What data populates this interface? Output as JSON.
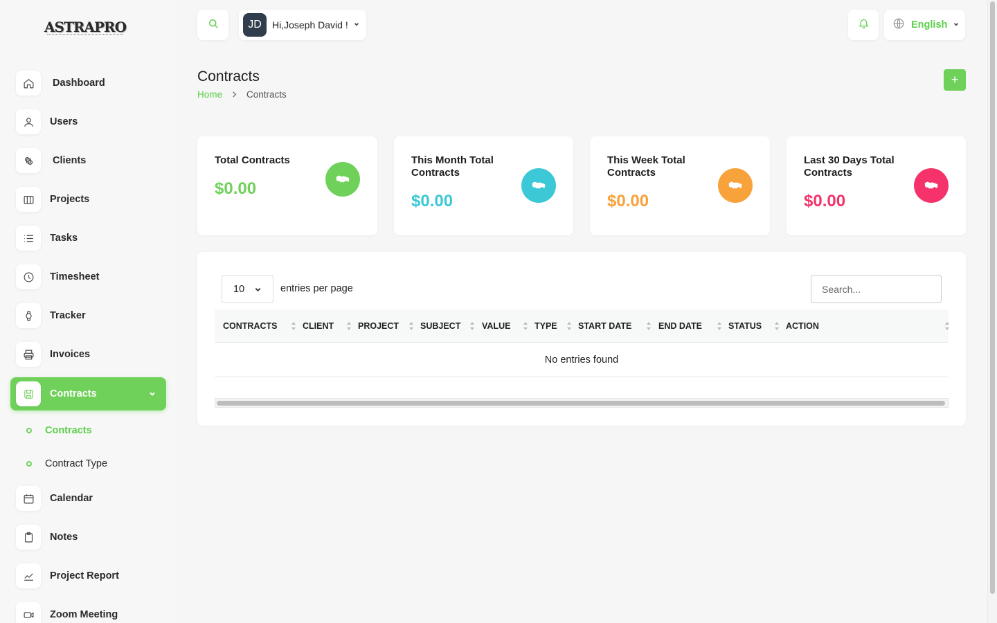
{
  "brand": {
    "logo_text": "ASTRAPRO"
  },
  "sidebar": {
    "items": [
      {
        "label": "Dashboard",
        "icon": "home-icon"
      },
      {
        "label": "Users",
        "icon": "user-icon"
      },
      {
        "label": "Clients",
        "icon": "clients-icon"
      },
      {
        "label": "Projects",
        "icon": "projects-icon"
      },
      {
        "label": "Tasks",
        "icon": "list-icon"
      },
      {
        "label": "Timesheet",
        "icon": "clock-icon"
      },
      {
        "label": "Tracker",
        "icon": "watch-icon"
      },
      {
        "label": "Invoices",
        "icon": "printer-icon"
      },
      {
        "label": "Contracts",
        "icon": "contract-icon",
        "active": true
      },
      {
        "label": "Calendar",
        "icon": "calendar-icon"
      },
      {
        "label": "Notes",
        "icon": "clipboard-icon"
      },
      {
        "label": "Project Report",
        "icon": "chart-icon"
      },
      {
        "label": "Zoom Meeting",
        "icon": "video-icon"
      }
    ],
    "contracts_submenu": [
      {
        "label": "Contracts",
        "active": true
      },
      {
        "label": "Contract Type",
        "active": false
      }
    ]
  },
  "header": {
    "user_initials": "JD",
    "user_greeting": "Hi,Joseph David !",
    "language": "English"
  },
  "page": {
    "title": "Contracts",
    "breadcrumb": {
      "home": "Home",
      "current": "Contracts"
    },
    "add_button": "+"
  },
  "stats": [
    {
      "title": "Total Contracts",
      "value": "$0.00",
      "color": "#6fd15a",
      "icon": "handshake-icon"
    },
    {
      "title": "This Month Total Contracts",
      "value": "$0.00",
      "color": "#3cc8d6",
      "icon": "handshake-icon"
    },
    {
      "title": "This Week Total Contracts",
      "value": "$0.00",
      "color": "#f8a23c",
      "icon": "handshake-icon"
    },
    {
      "title": "Last 30 Days Total Contracts",
      "value": "$0.00",
      "color": "#f5336a",
      "icon": "handshake-icon"
    }
  ],
  "table": {
    "per_page": "10",
    "per_page_label": "entries per page",
    "search_placeholder": "Search...",
    "columns": [
      "CONTRACTS",
      "CLIENT",
      "PROJECT",
      "SUBJECT",
      "VALUE",
      "TYPE",
      "START DATE",
      "END DATE",
      "STATUS",
      "ACTION"
    ],
    "empty_message": "No entries found"
  }
}
